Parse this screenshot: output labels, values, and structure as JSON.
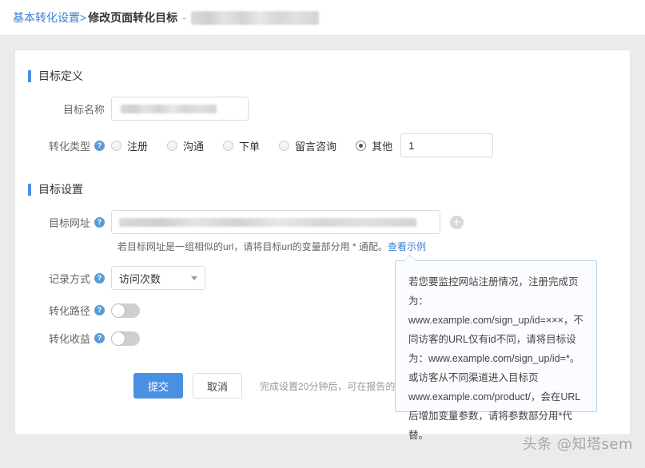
{
  "breadcrumb": {
    "parent_label": "基本转化设置>",
    "current_label": "修改页面转化目标",
    "separator": "-"
  },
  "sections": {
    "definition": {
      "title": "目标定义",
      "name_label": "目标名称",
      "type_label": "转化类型",
      "help_glyph": "?",
      "radio_options": [
        {
          "label": "注册",
          "checked": false
        },
        {
          "label": "沟通",
          "checked": false
        },
        {
          "label": "下单",
          "checked": false
        },
        {
          "label": "留言咨询",
          "checked": false
        },
        {
          "label": "其他",
          "checked": true
        }
      ],
      "other_value": "1"
    },
    "settings": {
      "title": "目标设置",
      "url_label": "目标网址",
      "add_glyph": "+",
      "hint_text": "若目标网址是一组相似的url，请将目标url的变量部分用 * 通配。",
      "hint_link": "查看示例",
      "record_label": "记录方式",
      "record_value": "访问次数",
      "path_label": "转化路径",
      "path_state": "off",
      "revenue_label": "转化收益",
      "revenue_state": "off"
    }
  },
  "actions": {
    "submit_label": "提交",
    "cancel_label": "取消",
    "hint": "完成设置20分钟后，可在报告的自定"
  },
  "tooltip": {
    "text": "若您要监控网站注册情况，注册完成页为：www.example.com/sign_up/id=×××，不同访客的URL仅有id不同，请将目标设为：www.example.com/sign_up/id=*。或访客从不同渠道进入目标页 www.example.com/product/，会在URL后增加变量参数，请将参数部分用*代替。"
  },
  "watermark": "头条 @知塔sem",
  "colors": {
    "accent": "#4a90e2",
    "link": "#3b7dd8",
    "page_bg": "#ebebeb"
  }
}
